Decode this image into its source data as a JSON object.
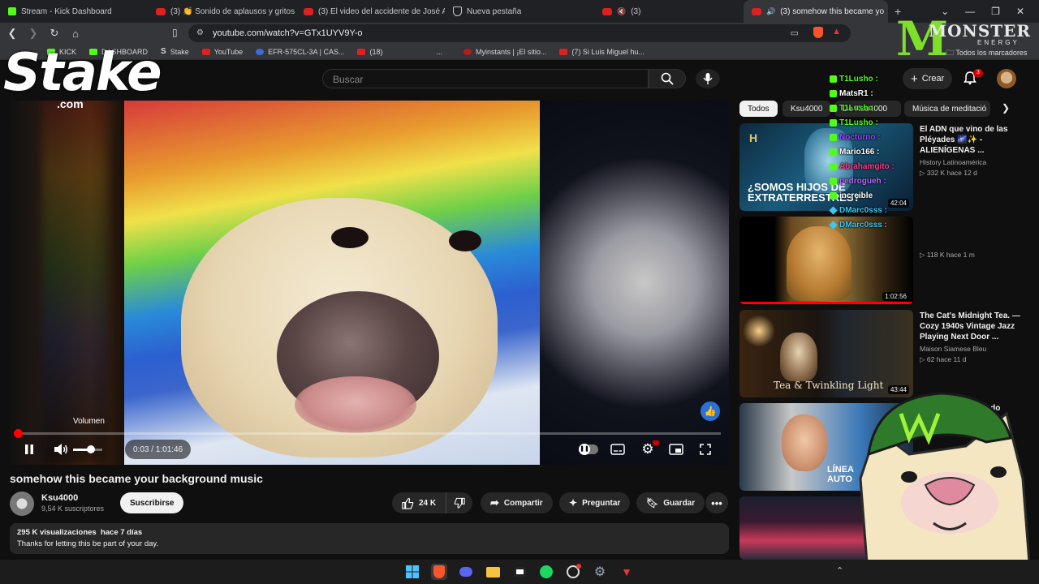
{
  "tabs": [
    {
      "title": "Stream - Kick Dashboard",
      "icon": "kick-icon",
      "active": false
    },
    {
      "title": "(3) 👏 Sonido de aplausos y gritos d",
      "icon": "youtube-icon",
      "active": false
    },
    {
      "title": "(3) El video del accidente de José Ar",
      "icon": "youtube-icon",
      "active": false
    },
    {
      "title": "Nueva pestaña",
      "icon": "brave-shield-icon",
      "active": false
    },
    {
      "title": "(3)",
      "icon": "youtube-icon",
      "active": false
    },
    {
      "title": "(3) somehow this became yo",
      "icon": "youtube-icon",
      "active": true
    }
  ],
  "address": {
    "url": "youtube.com/watch?v=GTx1UYV9Y-o"
  },
  "bookmarks": [
    {
      "label": "KICK",
      "icon": "kick-icon"
    },
    {
      "label": "DASHBOARD",
      "icon": "kick-icon"
    },
    {
      "label": "Stake",
      "icon": "stake-icon"
    },
    {
      "label": "YouTube",
      "icon": "youtube-icon"
    },
    {
      "label": "EFR-575CL-3A | CAS...",
      "icon": "casio-icon"
    },
    {
      "label": "(18)",
      "icon": "youtube-icon"
    },
    {
      "label": "...",
      "icon": ""
    },
    {
      "label": "Myinstants | ¡El sitio...",
      "icon": "myinstants-icon"
    },
    {
      "label": "(7) Si Luis Miguel hu...",
      "icon": "youtube-icon"
    }
  ],
  "bookmarks_right": "Todos los marcadores",
  "search": {
    "placeholder": "Buscar"
  },
  "header": {
    "create_label": "Crear",
    "notif_count": "3"
  },
  "player": {
    "volume_tooltip": "Volumen",
    "time": "0:03 / 1:01:46",
    "progress": 0.0008,
    "volume_level": 0.55
  },
  "video": {
    "title": "somehow this became your background music",
    "channel": "Ksu4000",
    "subscribers": "9,54 K suscriptores",
    "subscribe_label": "Suscribirse",
    "likes": "24 K",
    "share_label": "Compartir",
    "ask_label": "Preguntar",
    "save_label": "Guardar",
    "views_date": "295 K visualizaciones  hace 7 días",
    "description": "Thanks for letting this be part of your day."
  },
  "chips": [
    "Todos",
    "Ksu4000",
    "De Ksu4000",
    "Música de meditació"
  ],
  "related": [
    {
      "title": "El ADN que vino de las Pléyades 🌌✨ - ALIENÍGENAS ...",
      "channel": "History Latinoamérica",
      "meta": "332 K  hace 12 d",
      "duration": "42:04",
      "thumb_text": "¿SOMOS HIJOS DE EXTRATERRESTRES?"
    },
    {
      "title": "",
      "channel": "",
      "meta": "118 K  hace 1 m",
      "duration": "1:02:56",
      "thumb_text": ""
    },
    {
      "title": "The Cat's Midnight Tea. — Cozy 1940s Vintage Jazz Playing Next Door ...",
      "channel": "Maison Siamese Bleu",
      "meta": "62  hace 11 d",
      "duration": "43:44",
      "thumb_text": "Tea & Twinkling Light"
    },
    {
      "title": "ndo",
      "channel": "",
      "meta": "",
      "duration": "",
      "thumb_text": "LÍNEA AUTO"
    }
  ],
  "overlay": {
    "stake_logo": "Stake",
    "stake_com": ".com",
    "monster_word": "MONSTER",
    "monster_energy": "ENERGY",
    "chat": [
      {
        "user": "T1Lusho :",
        "color": "#53fc18",
        "badge": "kick"
      },
      {
        "user": "MatsR1 :",
        "color": "#ffffff",
        "badge": "kick"
      },
      {
        "user": "T1Lusho :",
        "color": "#53fc18",
        "badge": "kick"
      },
      {
        "user": "T1Lusho :",
        "color": "#53fc18",
        "badge": "kick"
      },
      {
        "user": "Nocturno :",
        "color": "#9146ff",
        "badge": "kick"
      },
      {
        "user": "Mario166 :",
        "color": "#ffffff",
        "badge": "kick"
      },
      {
        "user": "Abrahamgito :",
        "color": "#ff3b8b",
        "badge": "kick"
      },
      {
        "user": "pedrogueh :",
        "color": "#b86bff",
        "badge": "kick"
      },
      {
        "user": "increible",
        "color": "#ffffff",
        "badge": "kick"
      },
      {
        "user": "DMarc0sss :",
        "color": "#3ec8f0",
        "badge": "diamond"
      },
      {
        "user": "DMarc0sss :",
        "color": "#3ec8f0",
        "badge": "diamond"
      }
    ]
  },
  "colors": {
    "accent": "#ff0000",
    "kick_green": "#53fc18",
    "like_blue": "#2b72d8"
  }
}
